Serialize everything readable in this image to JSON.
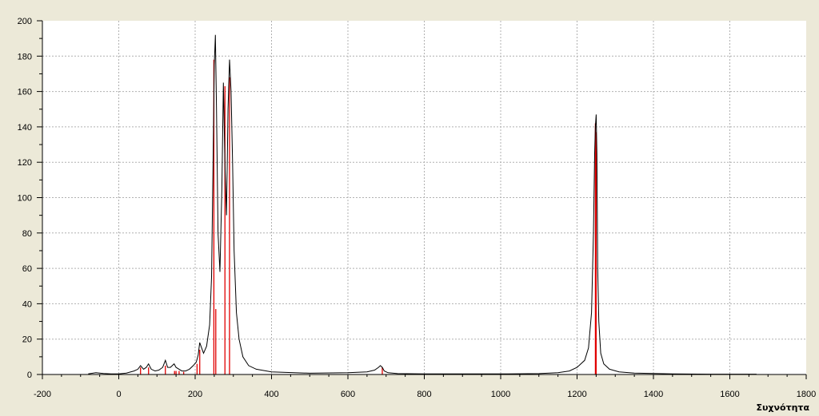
{
  "chart_data": {
    "type": "line",
    "title": "",
    "xlabel": "Συχνότητα",
    "ylabel": "",
    "xlim": [
      -200,
      1800
    ],
    "ylim": [
      0,
      200
    ],
    "x_ticks": [
      -200,
      0,
      200,
      400,
      600,
      800,
      1000,
      1200,
      1400,
      1600,
      1800
    ],
    "y_ticks": [
      0,
      20,
      40,
      60,
      80,
      100,
      120,
      140,
      160,
      180,
      200
    ],
    "grid": true,
    "colors": {
      "background": "#ece9d8",
      "plot_area": "#ffffff",
      "grid": "#b0b0b0",
      "spectrum": "#000000",
      "sticks": "#e00000"
    },
    "series": [
      {
        "type": "line",
        "x": [
          -80,
          -60,
          -40,
          -20,
          0,
          20,
          40,
          50,
          57,
          65,
          72,
          78,
          85,
          95,
          105,
          115,
          122,
          128,
          135,
          145,
          150,
          158,
          165,
          175,
          185,
          195,
          203,
          208,
          212,
          217,
          222,
          230,
          238,
          243,
          247,
          250,
          253,
          256,
          260,
          265,
          270,
          274,
          278,
          282,
          286,
          290,
          294,
          298,
          302,
          308,
          315,
          325,
          340,
          360,
          400,
          500,
          600,
          650,
          670,
          680,
          685,
          690,
          695,
          705,
          730,
          800,
          1000,
          1100,
          1150,
          1180,
          1200,
          1220,
          1230,
          1238,
          1243,
          1246,
          1248,
          1250,
          1252,
          1254,
          1257,
          1262,
          1270,
          1285,
          1310,
          1350,
          1450,
          1550,
          1670
        ],
        "y": [
          0.3,
          1,
          0.6,
          0.3,
          0.3,
          0.8,
          2,
          3,
          5,
          3,
          4,
          6,
          3,
          2,
          2.5,
          4,
          8,
          4,
          4,
          6,
          4,
          3,
          2,
          2,
          3,
          5,
          7,
          11,
          18,
          15,
          12,
          16,
          28,
          55,
          120,
          175,
          192,
          150,
          80,
          58,
          105,
          165,
          120,
          90,
          150,
          178,
          160,
          120,
          70,
          35,
          20,
          10,
          5,
          3,
          1.5,
          0.7,
          1,
          1.5,
          2.5,
          4,
          5,
          4,
          2,
          1,
          0.5,
          0.3,
          0.3,
          0.5,
          1,
          2,
          4,
          8,
          15,
          35,
          80,
          125,
          140,
          147,
          125,
          60,
          30,
          12,
          6,
          3,
          1.5,
          0.8,
          0.3,
          0.2,
          0.2
        ]
      },
      {
        "type": "stick",
        "x": [
          57,
          78,
          122,
          146,
          150,
          158,
          170,
          205,
          212,
          249,
          254,
          278,
          290,
          690,
          1248,
          1250
        ],
        "y": [
          4,
          4,
          5,
          2,
          2,
          2,
          1.5,
          6,
          14,
          178,
          37,
          163,
          168,
          4,
          142,
          137
        ]
      }
    ]
  }
}
